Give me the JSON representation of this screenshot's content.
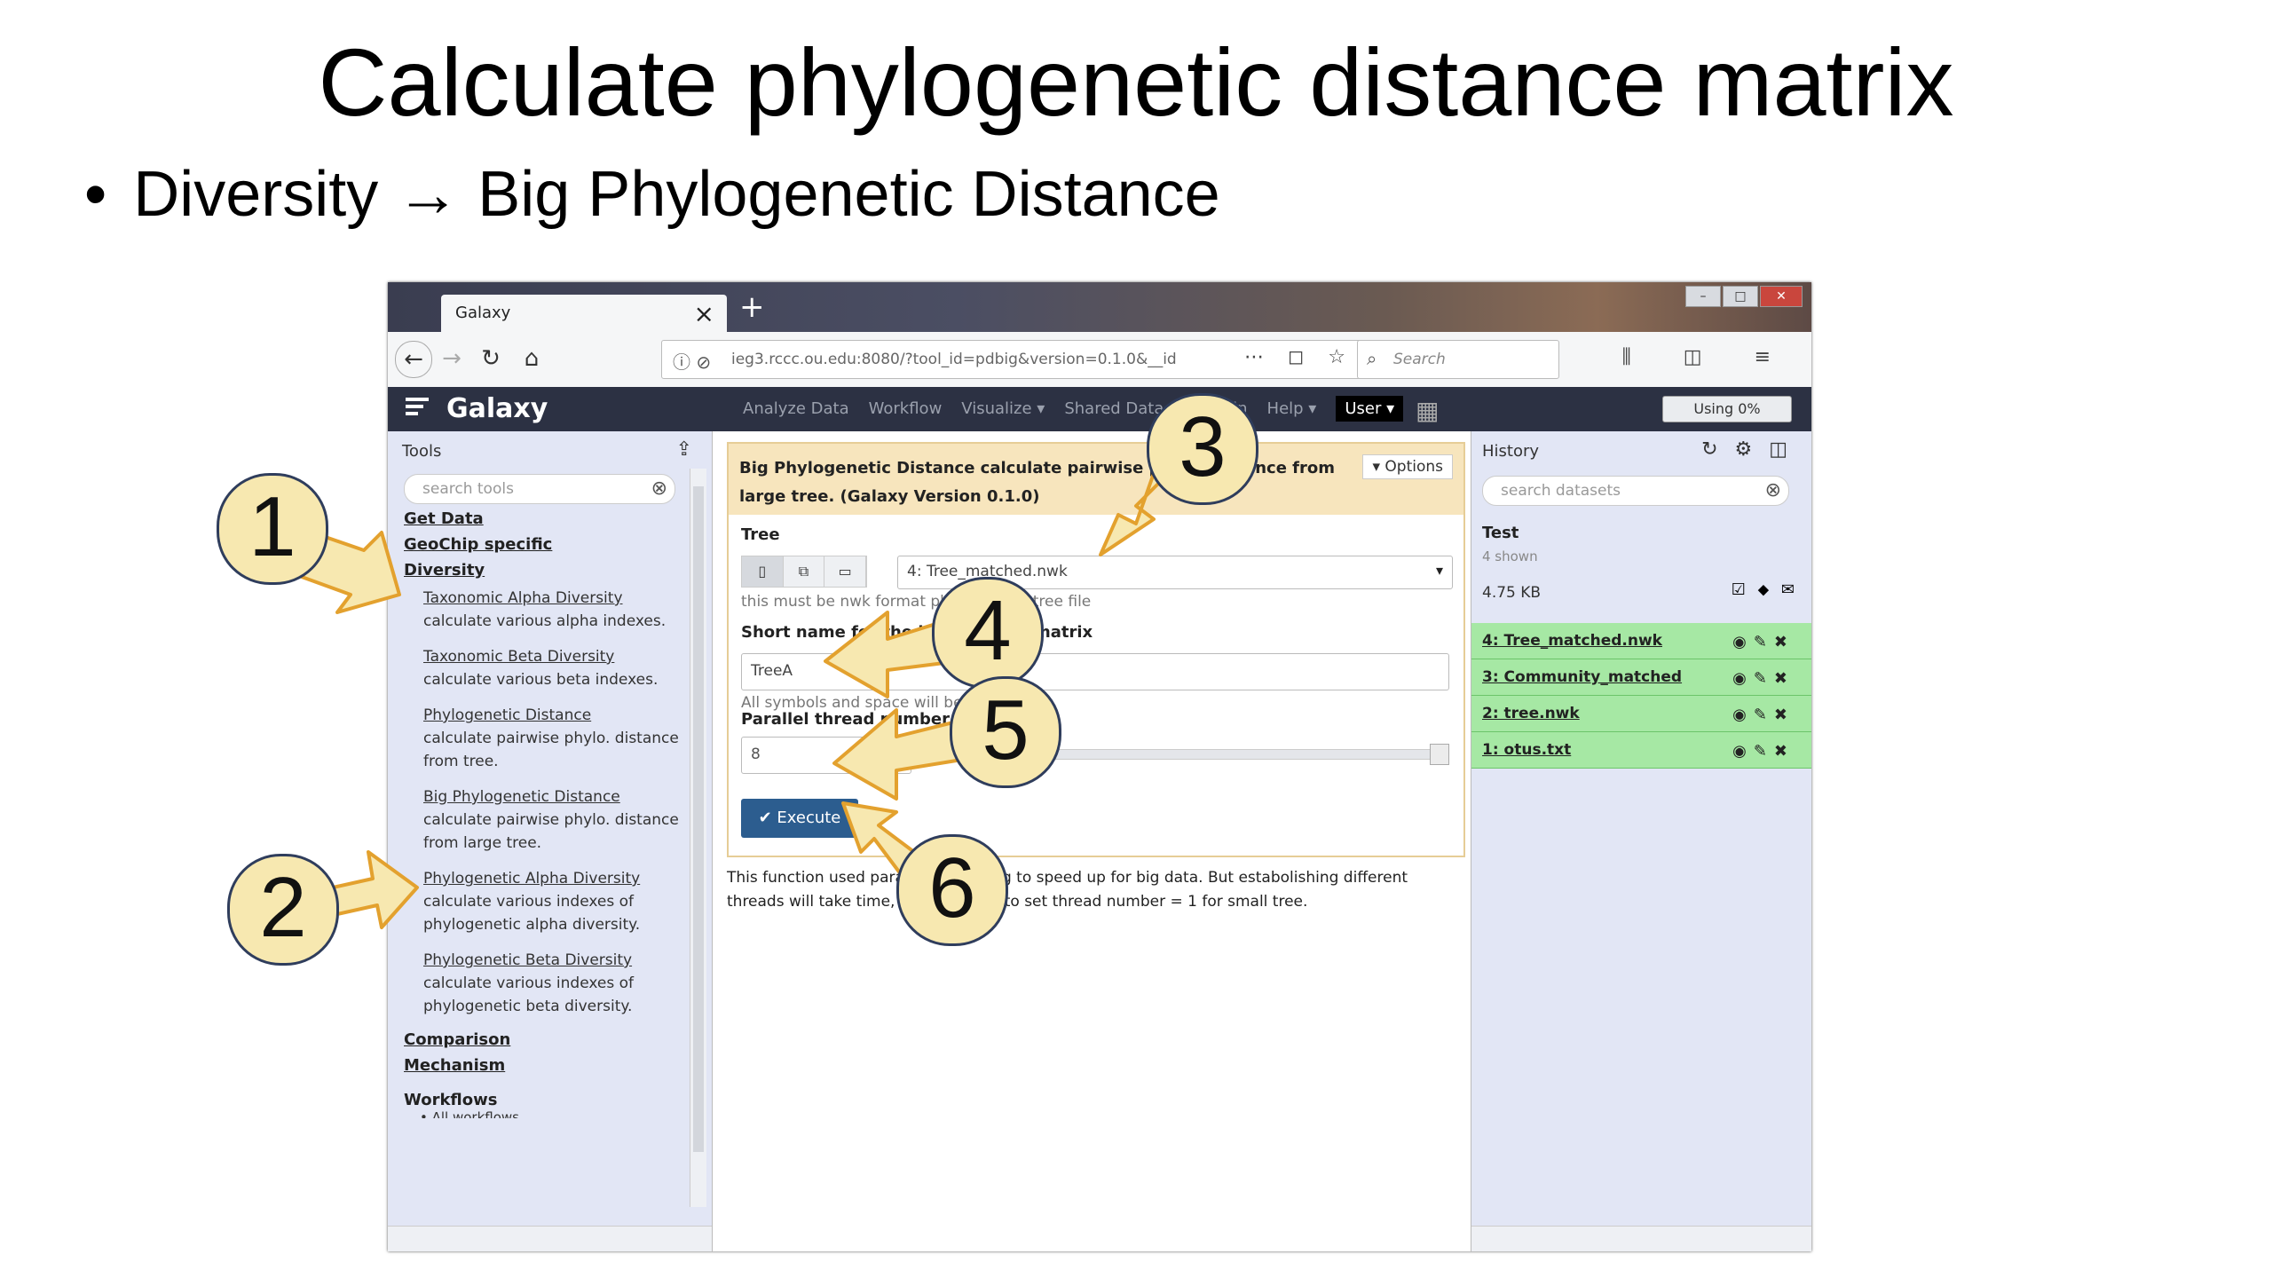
{
  "slide": {
    "title": "Calculate phylogenetic distance matrix",
    "bullet": "Diversity → Big Phylogenetic Distance"
  },
  "browser": {
    "tab_title": "Galaxy",
    "url": "ieg3.rccc.ou.edu:8080/?tool_id=pdbig&version=0.1.0&__id",
    "search_placeholder": "Search"
  },
  "galaxy": {
    "brand": "Galaxy",
    "menu": [
      "Analyze Data",
      "Workflow",
      "Visualize ▾",
      "Shared Data ▾",
      "Admin",
      "Help ▾"
    ],
    "user": "User ▾",
    "quota": "Using 0%"
  },
  "tools": {
    "title": "Tools",
    "search_placeholder": "search tools",
    "sections": {
      "get_data": "Get Data",
      "geochip": "GeoChip specific",
      "diversity": "Diversity",
      "comparison": "Comparison",
      "mechanism": "Mechanism"
    },
    "items": [
      {
        "link": "Taxonomic Alpha Diversity",
        "desc": "calculate various alpha indexes."
      },
      {
        "link": "Taxonomic Beta Diversity",
        "desc": "calculate various beta indexes."
      },
      {
        "link": "Phylogenetic Distance",
        "desc": "calculate pairwise phylo. distance from tree."
      },
      {
        "link": "Big Phylogenetic Distance",
        "desc": "calculate pairwise phylo. distance from large tree."
      },
      {
        "link": "Phylogenetic Alpha Diversity",
        "desc": "calculate various indexes of phylogenetic alpha diversity."
      },
      {
        "link": "Phylogenetic Beta Diversity",
        "desc": "calculate various indexes of phylogenetic beta diversity."
      }
    ],
    "workflows_title": "Workflows",
    "workflows_item": "• All workflows"
  },
  "form": {
    "header": "Big Phylogenetic Distance calculate pairwise phylo. distance from large tree. (Galaxy Version 0.1.0)",
    "options_label": "▾ Options",
    "tree_label": "Tree",
    "tree_value": "4: Tree_matched.nwk",
    "tree_help": "this must be nwk format phylogenetic tree file",
    "shortname_label": "Short name for the big distance matrix",
    "shortname_value": "TreeA",
    "shortname_help": "All symbols and space will be removed",
    "threads_label": "Parallel thread number",
    "threads_value": "8",
    "threads_slider": 1.0,
    "execute_label": "✔ Execute",
    "help_text": "This function used parallel computing to speed up for big data. But estabolishing different threads will take time, so it is better to set thread number = 1 for small tree."
  },
  "history": {
    "title": "History",
    "search_placeholder": "search datasets",
    "name": "Test",
    "shown": "4 shown",
    "size": "4.75 KB",
    "datasets": [
      {
        "label": "4: Tree_matched.nwk"
      },
      {
        "label": "3: Community_matched"
      },
      {
        "label": "2: tree.nwk"
      },
      {
        "label": "1: otus.txt"
      }
    ]
  },
  "callouts": [
    "1",
    "2",
    "3",
    "4",
    "5",
    "6"
  ],
  "colors": {
    "callout_fill": "#f7e8b0",
    "callout_border": "#2f3d5c",
    "dataset_ok": "#a6e8a4",
    "masthead": "#2c3143",
    "execute": "#2c5d8f"
  }
}
